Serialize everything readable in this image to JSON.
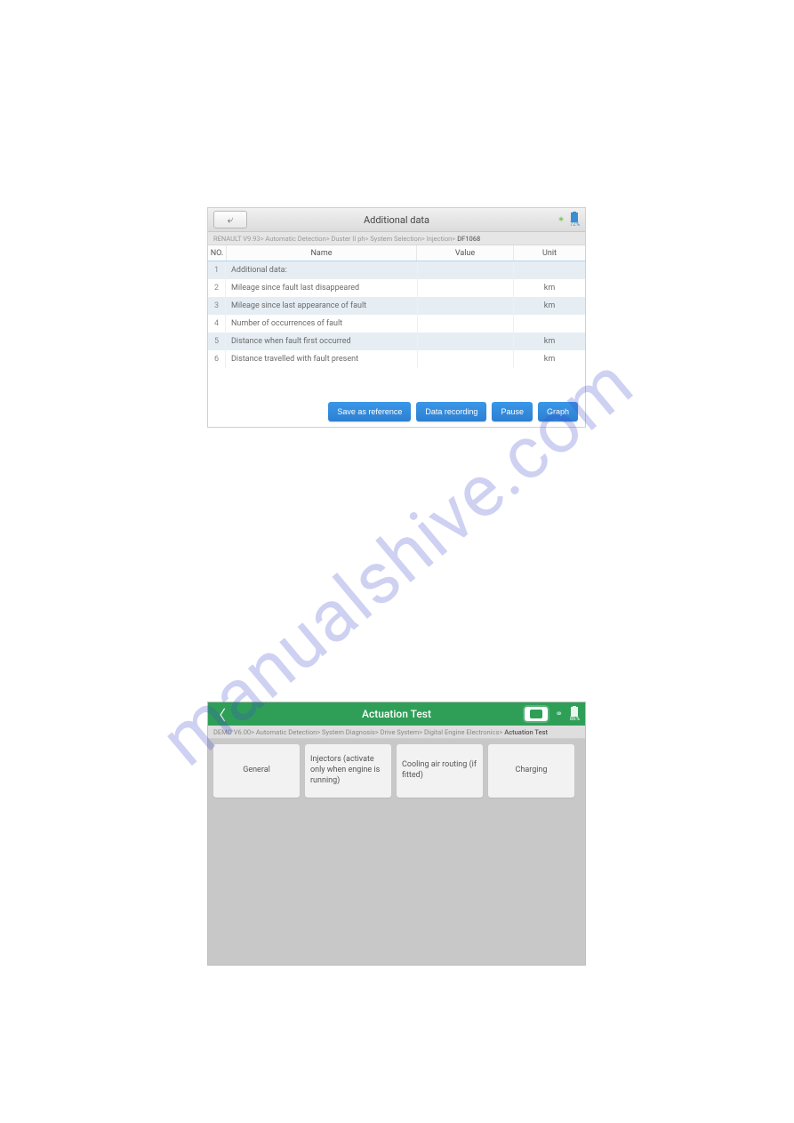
{
  "watermark": "manualshive.com",
  "panel1": {
    "title": "Additional data",
    "battery": "72%",
    "breadcrumb_path": "RENAULT V9.93> Automatic Detection> Duster II ph> System Selection> Injection> ",
    "breadcrumb_current": "DF1068",
    "columns": {
      "no": "NO.",
      "name": "Name",
      "value": "Value",
      "unit": "Unit"
    },
    "rows": [
      {
        "no": "1",
        "name": "Additional data:",
        "value": "",
        "unit": ""
      },
      {
        "no": "2",
        "name": "Mileage since fault last disappeared",
        "value": "",
        "unit": "km"
      },
      {
        "no": "3",
        "name": "Mileage since last appearance of fault",
        "value": "",
        "unit": "km"
      },
      {
        "no": "4",
        "name": "Number of occurrences of fault",
        "value": "",
        "unit": ""
      },
      {
        "no": "5",
        "name": "Distance when fault first occurred",
        "value": "",
        "unit": "km"
      },
      {
        "no": "6",
        "name": "Distance travelled with fault present",
        "value": "",
        "unit": "km"
      }
    ],
    "buttons": {
      "save": "Save as reference",
      "record": "Data recording",
      "pause": "Pause",
      "graph": "Graph"
    }
  },
  "panel2": {
    "title": "Actuation Test",
    "battery": "86%",
    "breadcrumb_path": "DEMO V6.00> Automatic Detection> System Diagnosis> Drive System> Digital Engine Electronics> ",
    "breadcrumb_current": "Actuation Test",
    "cards": {
      "general": "General",
      "injectors": "Injectors (activate only when engine is running)",
      "cooling": "Cooling air routing (if fitted)",
      "charging": "Charging"
    }
  }
}
